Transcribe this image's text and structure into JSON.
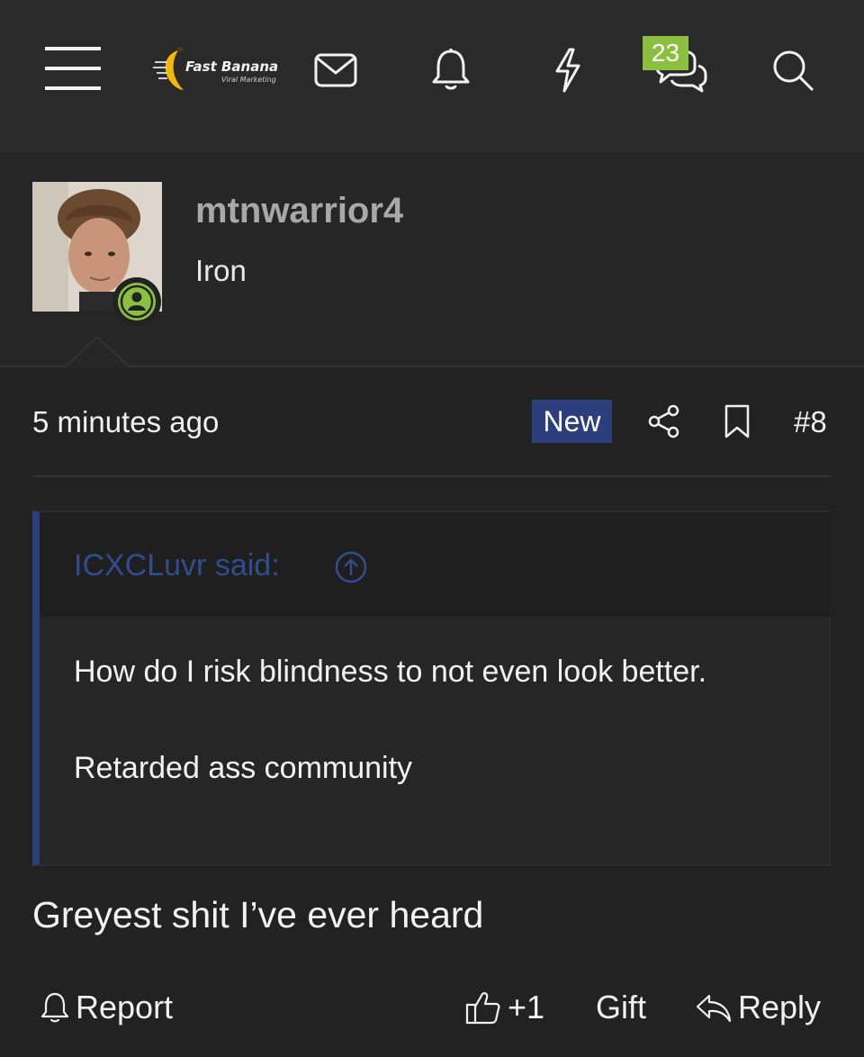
{
  "header": {
    "logo_text": "Fast Banana",
    "logo_subtext": "Viral Marketing",
    "conversations_badge": "23",
    "icons": [
      "menu-icon",
      "mail-icon",
      "bell-icon",
      "bolt-icon",
      "chat-icon",
      "search-icon"
    ]
  },
  "post": {
    "username": "mtnwarrior4",
    "user_title": "Iron",
    "time": "5 minutes ago",
    "new_label": "New",
    "post_number": "#8",
    "quote": {
      "author": "ICXCLuvr said:",
      "line1": "How do I risk blindness to not even look better.",
      "line2": "Retarded ass community"
    },
    "message": "Greyest shit I’ve ever heard",
    "actions": {
      "report": "Report",
      "like": "+1",
      "gift": "Gift",
      "reply": "Reply"
    }
  },
  "colors": {
    "background": "#222222",
    "topbar": "#2a2a2a",
    "accent_blue": "#2c3e7c",
    "badge_green": "#8bbf3f",
    "online_green": "#8bbf3f"
  }
}
